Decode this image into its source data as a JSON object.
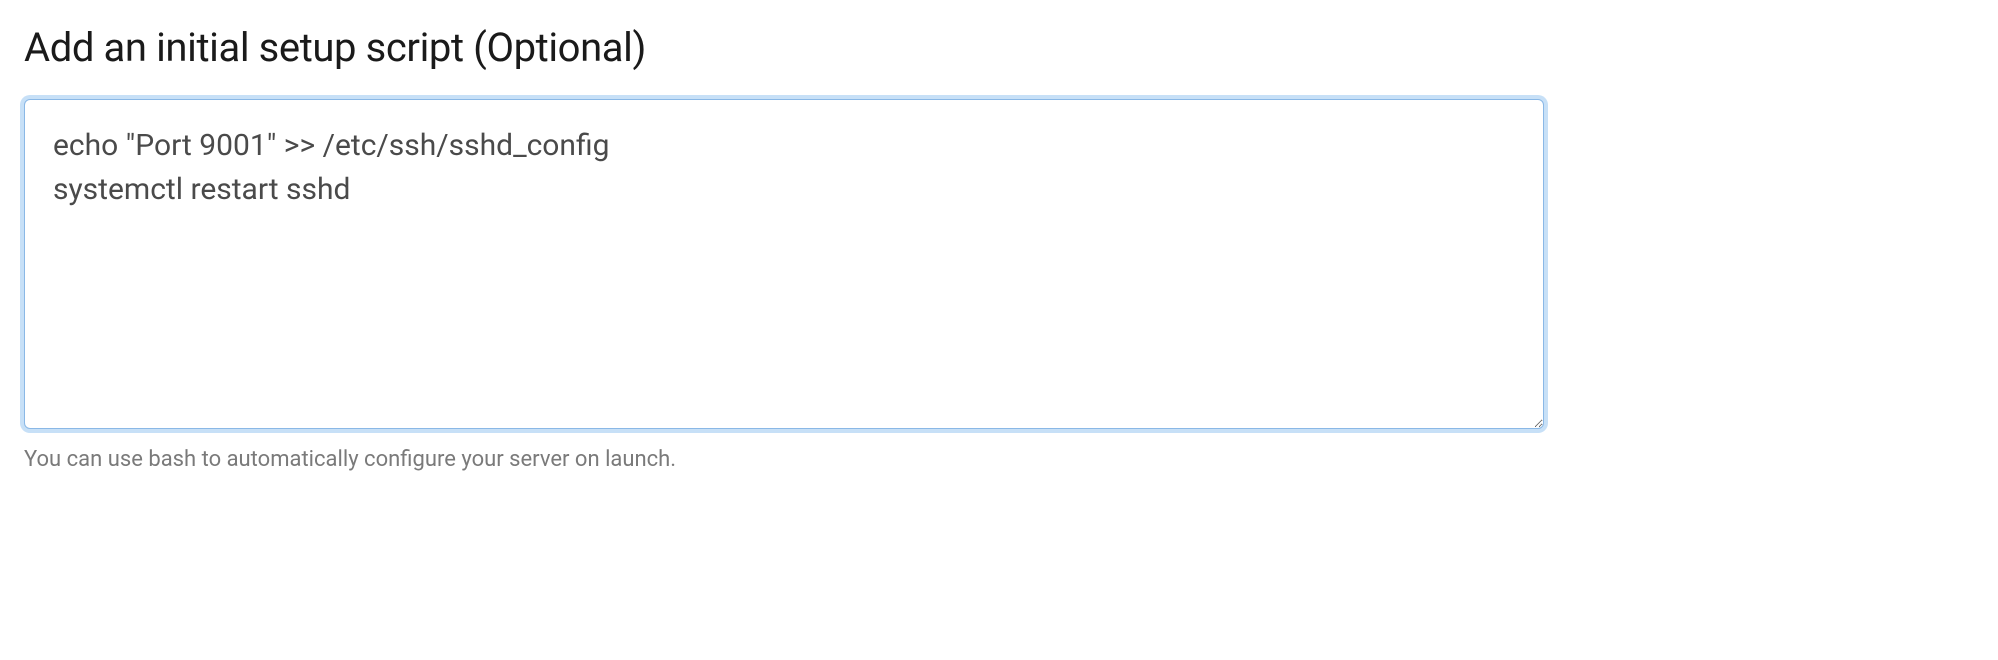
{
  "section": {
    "heading": "Add an initial setup script (Optional)",
    "script_value": "echo \"Port 9001\" >> /etc/ssh/sshd_config\nsystemctl restart sshd",
    "helper_text": "You can use bash to automatically configure your server on launch."
  }
}
